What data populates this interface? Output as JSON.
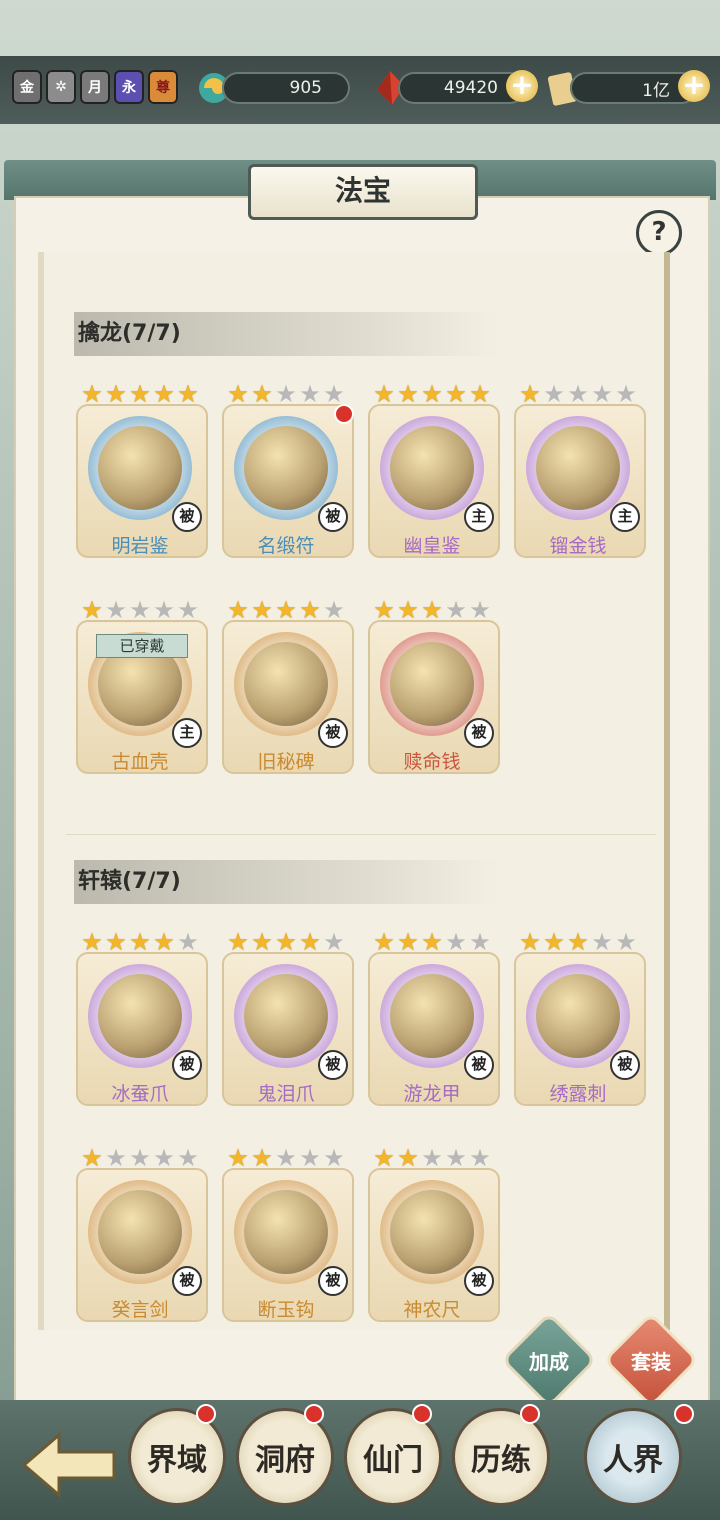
{
  "top_bar": {
    "ranks": [
      "金",
      "✲",
      "月",
      "永",
      "尊"
    ],
    "resources": [
      {
        "name": "spirit-jade",
        "value": "905"
      },
      {
        "name": "red-crystal",
        "value": "49420"
      },
      {
        "name": "silver-note",
        "value": "1亿"
      }
    ]
  },
  "panel": {
    "title": "法宝",
    "help": "?"
  },
  "sections": [
    {
      "title": "擒龙(7/7)",
      "items": [
        {
          "name": "明岩鉴",
          "stars": 5,
          "tag": "被",
          "color": "#4b8fb8"
        },
        {
          "name": "名缎符",
          "stars": 2,
          "tag": "被",
          "color": "#4b8fb8",
          "red_dot": true
        },
        {
          "name": "幽皇鉴",
          "stars": 5,
          "tag": "主",
          "color": "#a66bc3"
        },
        {
          "name": "镏金钱",
          "stars": 1,
          "tag": "主",
          "color": "#a66bc3"
        },
        {
          "name": "古血壳",
          "stars": 1,
          "tag": "主",
          "color": "#c98b32",
          "equipped": "已穿戴"
        },
        {
          "name": "旧秘碑",
          "stars": 4,
          "tag": "被",
          "color": "#c98b32"
        },
        {
          "name": "赎命钱",
          "stars": 3,
          "tag": "被",
          "color": "#c9553f"
        }
      ]
    },
    {
      "title": "轩辕(7/7)",
      "items": [
        {
          "name": "冰蚕爪",
          "stars": 4,
          "tag": "被",
          "color": "#a66bc3"
        },
        {
          "name": "鬼泪爪",
          "stars": 4,
          "tag": "被",
          "color": "#a66bc3"
        },
        {
          "name": "游龙甲",
          "stars": 3,
          "tag": "被",
          "color": "#a66bc3"
        },
        {
          "name": "绣露刺",
          "stars": 3,
          "tag": "被",
          "color": "#a66bc3"
        },
        {
          "name": "癸言剑",
          "stars": 1,
          "tag": "被",
          "color": "#c98b32"
        },
        {
          "name": "断玉钩",
          "stars": 2,
          "tag": "被",
          "color": "#c98b32"
        },
        {
          "name": "神农尺",
          "stars": 2,
          "tag": "被",
          "color": "#c98b32"
        }
      ]
    }
  ],
  "actions": {
    "bonus": "加成",
    "set": "套装"
  },
  "nav": {
    "items": [
      "界域",
      "洞府",
      "仙门",
      "历练"
    ],
    "realm": "人界"
  }
}
